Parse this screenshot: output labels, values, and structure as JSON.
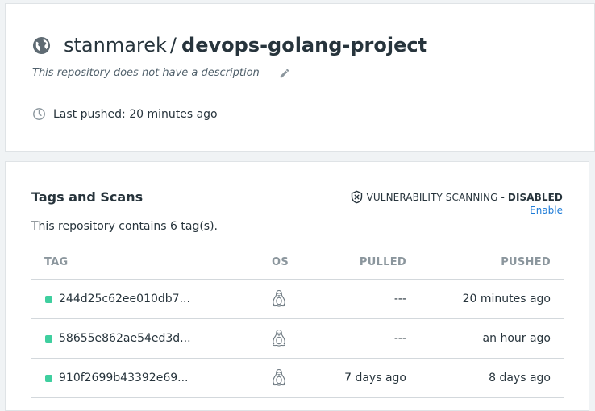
{
  "repo": {
    "owner": "stanmarek",
    "separator": "/",
    "name": "devops-golang-project",
    "description": "This repository does not have a description",
    "last_pushed": "Last pushed: 20 minutes ago"
  },
  "tags_section": {
    "title": "Tags and Scans",
    "vuln_label": "VULNERABILITY SCANNING -",
    "vuln_status": "DISABLED",
    "enable_label": "Enable",
    "tag_count_text": "This repository contains 6 tag(s).",
    "columns": [
      "TAG",
      "OS",
      "PULLED",
      "PUSHED"
    ],
    "rows": [
      {
        "tag": "244d25c62ee010db7...",
        "os_icon": "linux-icon",
        "pulled": "---",
        "pushed": "20 minutes ago"
      },
      {
        "tag": "58655e862ae54ed3d...",
        "os_icon": "linux-icon",
        "pulled": "---",
        "pushed": "an hour ago"
      },
      {
        "tag": "910f2699b43392e69...",
        "os_icon": "linux-icon",
        "pulled": "7 days ago",
        "pushed": "8 days ago"
      }
    ]
  },
  "icons": {
    "visibility": "globe-icon",
    "edit": "pencil-icon",
    "time": "clock-icon",
    "scan": "shield-x-icon"
  },
  "colors": {
    "link": "#1d7bd7",
    "status_dot": "#3fcf9f",
    "text": "#27343c",
    "muted": "#8b969d"
  }
}
